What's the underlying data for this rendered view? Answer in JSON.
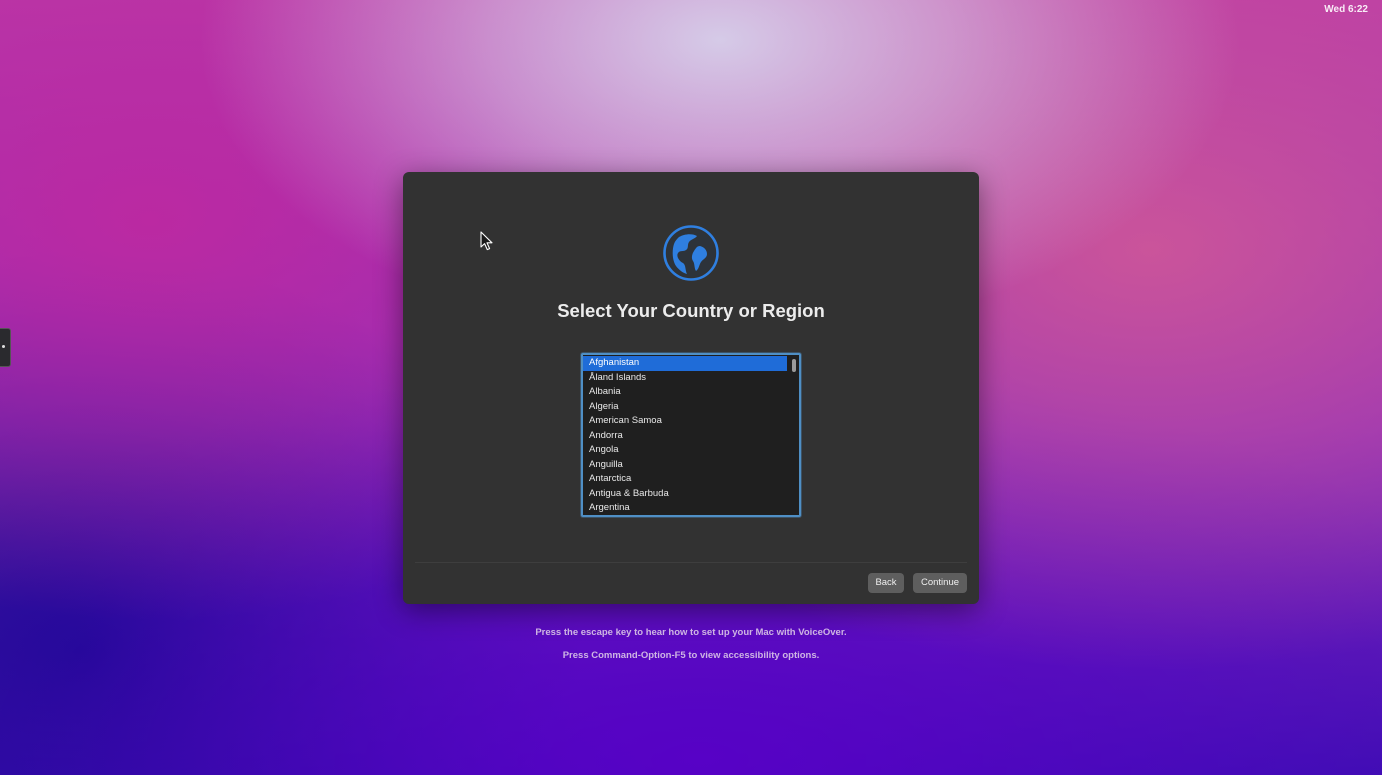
{
  "menubar": {
    "clock": "Wed 6:22"
  },
  "setup": {
    "icon": "globe-icon",
    "title": "Select Your Country or Region",
    "countries": [
      "Afghanistan",
      "Åland Islands",
      "Albania",
      "Algeria",
      "American Samoa",
      "Andorra",
      "Angola",
      "Anguilla",
      "Antarctica",
      "Antigua & Barbuda",
      "Argentina"
    ],
    "selected": "Afghanistan",
    "back_label": "Back",
    "continue_label": "Continue"
  },
  "hints": {
    "voiceover": "Press the escape key to hear how to set up your Mac with VoiceOver.",
    "accessibility": "Press Command-Option-F5 to view accessibility options."
  },
  "colors": {
    "accent": "#1f6cd8",
    "icon_blue": "#2f7fe0"
  }
}
